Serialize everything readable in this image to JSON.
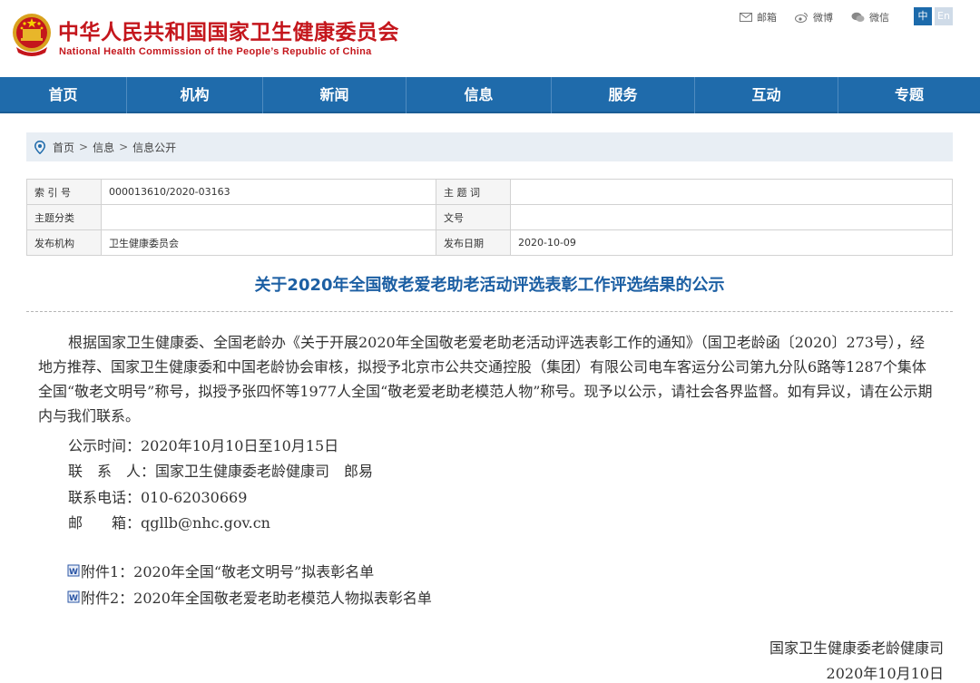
{
  "header": {
    "title_cn": "中华人民共和国国家卫生健康委员会",
    "title_en": "National Health Commission of the People’s Republic of China",
    "links": [
      {
        "icon": "mail-icon",
        "label": "邮箱"
      },
      {
        "icon": "weibo-icon",
        "label": "微博"
      },
      {
        "icon": "wechat-icon",
        "label": "微信"
      }
    ],
    "lang_cn": "中",
    "lang_en": "En"
  },
  "nav": [
    "首页",
    "机构",
    "新闻",
    "信息",
    "服务",
    "互动",
    "专题"
  ],
  "breadcrumb": [
    "首页",
    "信息",
    "信息公开"
  ],
  "meta": {
    "index_label": "索 引 号",
    "index_value": "000013610/2020-03163",
    "keyword_label": "主 题 词",
    "keyword_value": "",
    "category_label": "主题分类",
    "category_value": "",
    "docno_label": "文号",
    "docno_value": "",
    "org_label": "发布机构",
    "org_value": "卫生健康委员会",
    "date_label": "发布日期",
    "date_value": "2020-10-09"
  },
  "article": {
    "title": "关于2020年全国敬老爱老助老活动评选表彰工作评选结果的公示",
    "paragraph": "根据国家卫生健康委、全国老龄办《关于开展2020年全国敬老爱老助老活动评选表彰工作的通知》（国卫老龄函〔2020〕273号），经地方推荐、国家卫生健康委和中国老龄协会审核，拟授予北京市公共交通控股（集团）有限公司电车客运分公司第九分队6路等1287个集体全国“敬老文明号”称号，拟授予张四怀等1977人全国“敬老爱老助老模范人物”称号。现予以公示，请社会各界监督。如有异议，请在公示期内与我们联系。",
    "period": "公示时间：2020年10月10日至10月15日",
    "contact": "联　系　人：国家卫生健康委老龄健康司　郎易",
    "phone": "联系电话：010-62030669",
    "email": "邮　　箱：qgllb@nhc.gov.cn",
    "attachment1": "附件1：2020年全国“敬老文明号”拟表彰名单",
    "attachment2": "附件2：2020年全国敬老爱老助老模范人物拟表彰名单",
    "signer": "国家卫生健康委老龄健康司",
    "sign_date": "2020年10月10日"
  },
  "colors": {
    "brand_red": "#c4161c",
    "nav_blue": "#1f6bab",
    "title_blue": "#1c5fa3"
  }
}
